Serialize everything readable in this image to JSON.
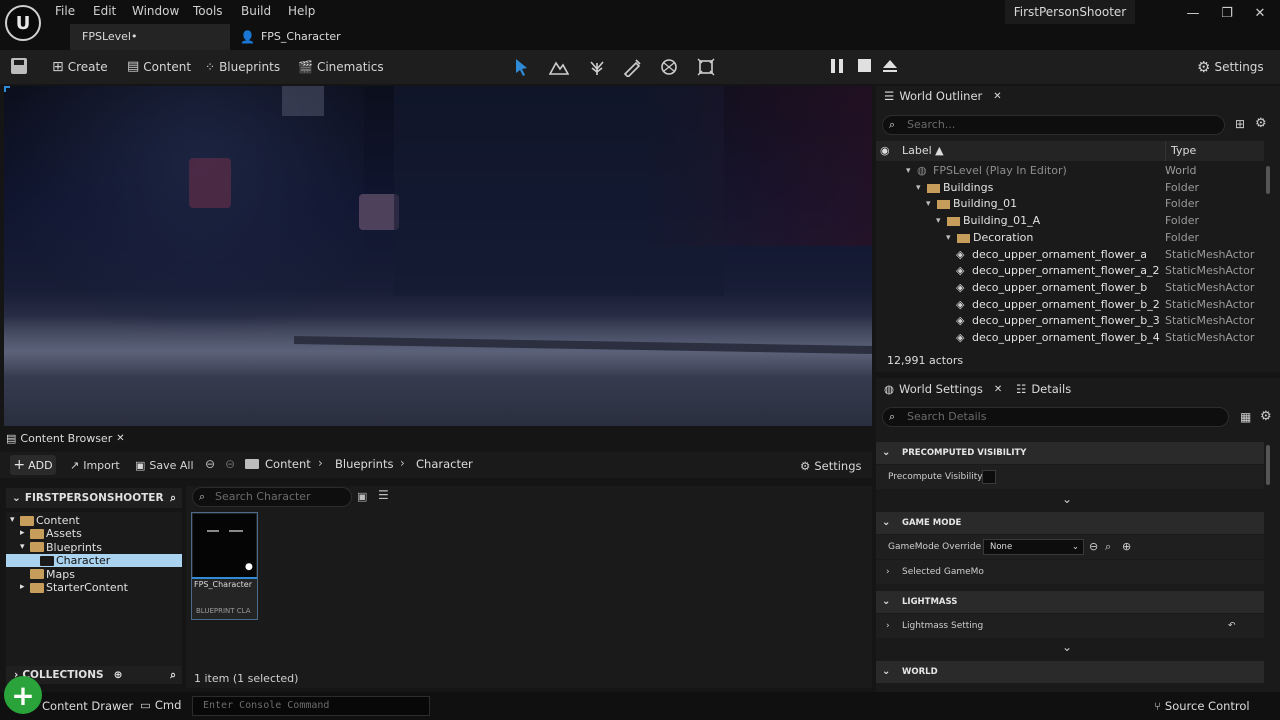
{
  "app": {
    "logo_text": "U",
    "project_name": "FirstPersonShooter",
    "menu": [
      "File",
      "Edit",
      "Window",
      "Tools",
      "Build",
      "Help"
    ],
    "window_controls": {
      "minimize": "—",
      "maximize": "❐",
      "close": "✕"
    }
  },
  "doc_tabs": [
    {
      "label": "FPSLevel•",
      "active": true
    },
    {
      "label": "FPS_Character",
      "active": false
    }
  ],
  "toolbar": {
    "create": "Create",
    "content": "Content",
    "blueprints": "Blueprints",
    "cinematics": "Cinematics",
    "settings": "Settings"
  },
  "content_browser": {
    "tab_label": "Content Browser",
    "add": "ADD",
    "import": "Import",
    "save_all": "Save All",
    "breadcrumb": [
      "Content",
      "Blueprints",
      "Character"
    ],
    "settings": "Settings",
    "root_label": "FIRSTPERSONSHOOTER",
    "search_placeholder": "Search Character",
    "tree": [
      {
        "label": "Content",
        "depth": 0,
        "expanded": true
      },
      {
        "label": "Assets",
        "depth": 1,
        "expanded": false
      },
      {
        "label": "Blueprints",
        "depth": 1,
        "expanded": true
      },
      {
        "label": "Character",
        "depth": 2,
        "selected": true
      },
      {
        "label": "Maps",
        "depth": 1
      },
      {
        "label": "StarterContent",
        "depth": 1,
        "expanded": false
      }
    ],
    "asset": {
      "name": "FPS_Character",
      "type": "BLUEPRINT CLA"
    },
    "collections": "COLLECTIONS",
    "item_count": "1 item (1 selected)"
  },
  "status_bar": {
    "content_drawer": "Content Drawer",
    "cmd": "Cmd",
    "console_placeholder": "Enter Console Command",
    "source_control": "Source Control"
  },
  "world_outliner": {
    "tab_label": "World Outliner",
    "search_placeholder": "Search...",
    "col_label": "Label ▲",
    "col_type": "Type",
    "rows": [
      {
        "label": "FPSLevel (Play In Editor)",
        "type": "World",
        "depth": 0,
        "kind": "world"
      },
      {
        "label": "Buildings",
        "type": "Folder",
        "depth": 1,
        "kind": "folder"
      },
      {
        "label": "Building_01",
        "type": "Folder",
        "depth": 2,
        "kind": "folder"
      },
      {
        "label": "Building_01_A",
        "type": "Folder",
        "depth": 3,
        "kind": "folder"
      },
      {
        "label": "Decoration",
        "type": "Folder",
        "depth": 4,
        "kind": "folder"
      },
      {
        "label": "deco_upper_ornament_flower_a",
        "type": "StaticMeshActor",
        "depth": 5,
        "kind": "mesh"
      },
      {
        "label": "deco_upper_ornament_flower_a_2",
        "type": "StaticMeshActor",
        "depth": 5,
        "kind": "mesh"
      },
      {
        "label": "deco_upper_ornament_flower_b",
        "type": "StaticMeshActor",
        "depth": 5,
        "kind": "mesh"
      },
      {
        "label": "deco_upper_ornament_flower_b_2",
        "type": "StaticMeshActor",
        "depth": 5,
        "kind": "mesh"
      },
      {
        "label": "deco_upper_ornament_flower_b_3",
        "type": "StaticMeshActor",
        "depth": 5,
        "kind": "mesh"
      },
      {
        "label": "deco_upper_ornament_flower_b_4",
        "type": "StaticMeshActor",
        "depth": 5,
        "kind": "mesh"
      }
    ],
    "actor_count": "12,991 actors"
  },
  "details": {
    "tab_world_settings": "World Settings",
    "tab_details": "Details",
    "search_placeholder": "Search Details",
    "sections": {
      "precomputed_visibility": "PRECOMPUTED VISIBILITY",
      "game_mode": "GAME MODE",
      "lightmass": "LIGHTMASS",
      "world": "WORLD"
    },
    "precompute_visibility": "Precompute Visibility",
    "gamemode_override": "GameMode Override",
    "gamemode_value": "None",
    "selected_gamemode": "Selected GameMo",
    "lightmass_settings": "Lightmass Setting"
  },
  "colors": {
    "accent_blue": "#2f8bd8",
    "selection": "#a9d3ee",
    "folder": "#c69d5a"
  }
}
